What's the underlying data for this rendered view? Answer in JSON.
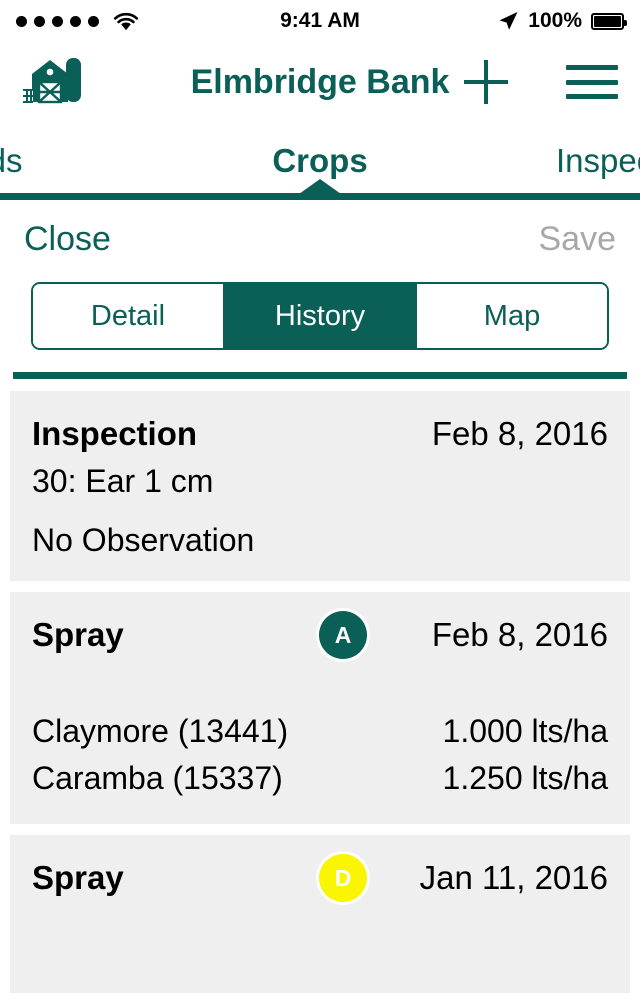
{
  "status_bar": {
    "signal_dots": 5,
    "wifi_icon": "wifi-icon",
    "time": "9:41 AM",
    "location_icon": "location-arrow-icon",
    "battery_percent": "100%",
    "battery_level": 100
  },
  "app_header": {
    "brand_icon": "barn-silo-icon",
    "title": "Elmbridge Bank",
    "add_icon": "plus-icon",
    "menu_icon": "hamburger-menu-icon"
  },
  "top_tabs": {
    "items": [
      {
        "label": "elds",
        "active": false
      },
      {
        "label": "Crops",
        "active": true
      },
      {
        "label": "Inspect",
        "active": false
      }
    ]
  },
  "modal_toolbar": {
    "close_label": "Close",
    "save_label": "Save",
    "save_enabled": false
  },
  "segmented_control": {
    "options": [
      {
        "label": "Detail",
        "selected": false
      },
      {
        "label": "History",
        "selected": true
      },
      {
        "label": "Map",
        "selected": false
      }
    ]
  },
  "history": {
    "entries": [
      {
        "title": "Inspection",
        "date": "Feb 8, 2016",
        "growth_stage": "30: Ear 1 cm",
        "note": "No Observation"
      },
      {
        "title": "Spray",
        "badge_letter": "A",
        "badge_color": "#0a5f57",
        "date": "Feb 8, 2016",
        "products": [
          {
            "name": "Claymore (13441)",
            "rate": "1.000 lts/ha"
          },
          {
            "name": "Caramba (15337)",
            "rate": "1.250 lts/ha"
          }
        ]
      },
      {
        "title": "Spray",
        "badge_letter": "D",
        "badge_color": "#faf500",
        "date": "Jan 11, 2016"
      }
    ]
  },
  "colors": {
    "brand_teal": "#0a5f57",
    "card_bg": "#efefef",
    "disabled_grey": "#a8a8a8",
    "badge_yellow": "#faf500"
  }
}
